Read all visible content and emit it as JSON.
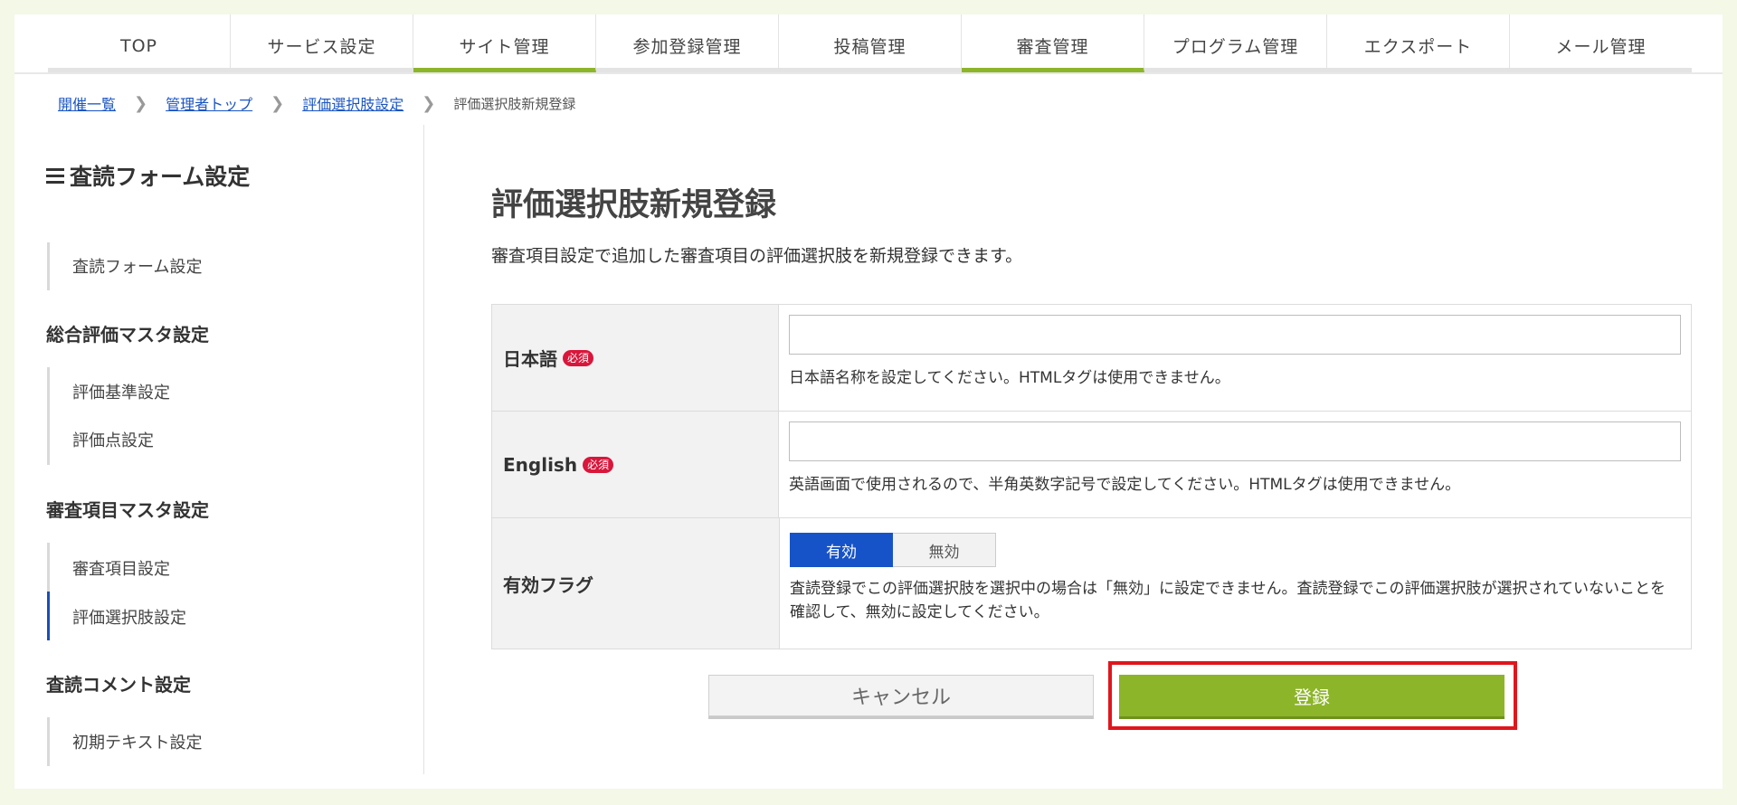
{
  "nav": {
    "items": [
      {
        "label": "TOP",
        "active": false
      },
      {
        "label": "サービス設定",
        "active": false
      },
      {
        "label": "サイト管理",
        "active": true
      },
      {
        "label": "参加登録管理",
        "active": false
      },
      {
        "label": "投稿管理",
        "active": false
      },
      {
        "label": "審査管理",
        "active": true
      },
      {
        "label": "プログラム管理",
        "active": false
      },
      {
        "label": "エクスポート",
        "active": false
      },
      {
        "label": "メール管理",
        "active": false
      }
    ]
  },
  "breadcrumb": {
    "items": [
      "開催一覧",
      "管理者トップ",
      "評価選択肢設定"
    ],
    "current": "評価選択肢新規登録"
  },
  "sidebar": {
    "title": "査読フォーム設定",
    "groups": [
      {
        "label": "査読フォーム設定"
      },
      {
        "label": "総合評価マスタ設定"
      },
      {
        "label": "審査項目マスタ設定"
      },
      {
        "label": "査読コメント設定"
      }
    ],
    "items": {
      "form": "査読フォーム設定",
      "criteria": "評価基準設定",
      "score": "評価点設定",
      "review_item": "審査項目設定",
      "choice": "評価選択肢設定",
      "initial_text": "初期テキスト設定"
    }
  },
  "main": {
    "title": "評価選択肢新規登録",
    "description": "審査項目設定で追加した審査項目の評価選択肢を新規登録できます。",
    "required_badge": "必須",
    "fields": {
      "ja": {
        "label": "日本語",
        "value": "",
        "hint": "日本語名称を設定してください。HTMLタグは使用できません。"
      },
      "en": {
        "label": "English",
        "value": "",
        "hint": "英語画面で使用されるので、半角英数字記号で設定してください。HTMLタグは使用できません。"
      },
      "flag": {
        "label": "有効フラグ",
        "on_label": "有効",
        "off_label": "無効",
        "selected": "有効",
        "hint": "査読登録でこの評価選択肢を選択中の場合は「無効」に設定できません。査読登録でこの評価選択肢が選択されていないことを確認して、無効に設定してください。"
      }
    },
    "buttons": {
      "cancel": "キャンセル",
      "submit": "登録"
    }
  },
  "colors": {
    "accent_green": "#8db52a",
    "primary_blue": "#1753c8",
    "required_red": "#d9163b",
    "highlight_red": "#e0161d"
  }
}
